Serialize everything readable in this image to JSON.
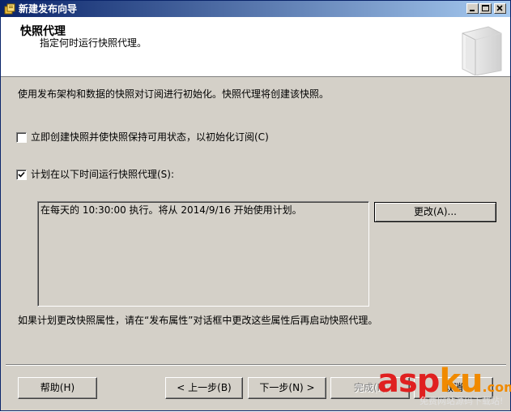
{
  "window": {
    "title": "新建发布向导"
  },
  "header": {
    "title": "快照代理",
    "subtitle": "指定何时运行快照代理。"
  },
  "main": {
    "description": "使用发布架构和数据的快照对订阅进行初始化。快照代理将创建该快照。",
    "option_immediate": {
      "label": "立即创建快照并使快照保持可用状态，以初始化订阅(C)",
      "checked": false
    },
    "option_schedule": {
      "label": "计划在以下时间运行快照代理(S):",
      "checked": true
    },
    "schedule_text": "在每天的 10:30:00 执行。将从 2014/9/16 开始使用计划。",
    "change_button": "更改(A)...",
    "note": "如果计划更改快照属性，请在“发布属性”对话框中更改这些属性后再启动快照代理。"
  },
  "footer": {
    "help": "帮助(H)",
    "back": "< 上一步(B)",
    "next": "下一步(N) >",
    "finish": "完成(F)",
    "cancel": "取消"
  },
  "watermark": {
    "text_a": "asp",
    "text_b": "ku",
    "text_c": ".com",
    "subtext": "免费网站源码下载站!"
  },
  "colors": {
    "titlebar_start": "#0a246a",
    "titlebar_end": "#a6caf0",
    "dialog_bg": "#d4d0c8",
    "watermark_red": "#e02020",
    "watermark_orange": "#f08a00"
  }
}
